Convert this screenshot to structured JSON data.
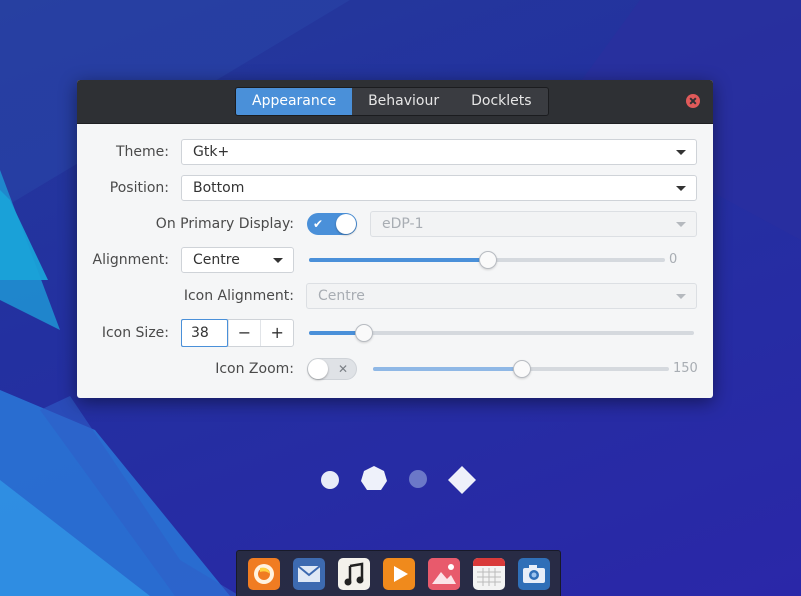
{
  "colors": {
    "accent": "#4a90d9",
    "titlebar": "#2e3034",
    "dialog_bg": "#f5f6f7",
    "close": "#e05a5a"
  },
  "tabs": [
    {
      "label": "Appearance",
      "active": true
    },
    {
      "label": "Behaviour",
      "active": false
    },
    {
      "label": "Docklets",
      "active": false
    }
  ],
  "theme": {
    "label": "Theme:",
    "value": "Gtk+"
  },
  "position": {
    "label": "Position:",
    "value": "Bottom"
  },
  "primary_display": {
    "label": "On Primary Display:",
    "enabled": true,
    "value": "eDP-1"
  },
  "alignment": {
    "label": "Alignment:",
    "value": "Centre",
    "offset": "0",
    "offset_fraction": 0.5
  },
  "icon_alignment": {
    "label": "Icon Alignment:",
    "value": "Centre"
  },
  "icon_size": {
    "label": "Icon Size:",
    "value": "38",
    "minus": "−",
    "plus": "+",
    "fraction": 0.14
  },
  "icon_zoom": {
    "label": "Icon Zoom:",
    "enabled": false,
    "value": "150",
    "fraction": 0.5
  },
  "dock": {
    "icons": [
      "firefox-icon",
      "mail-icon",
      "music-icon",
      "media-player-icon",
      "photos-icon",
      "calendar-icon",
      "screenshot-icon"
    ]
  }
}
